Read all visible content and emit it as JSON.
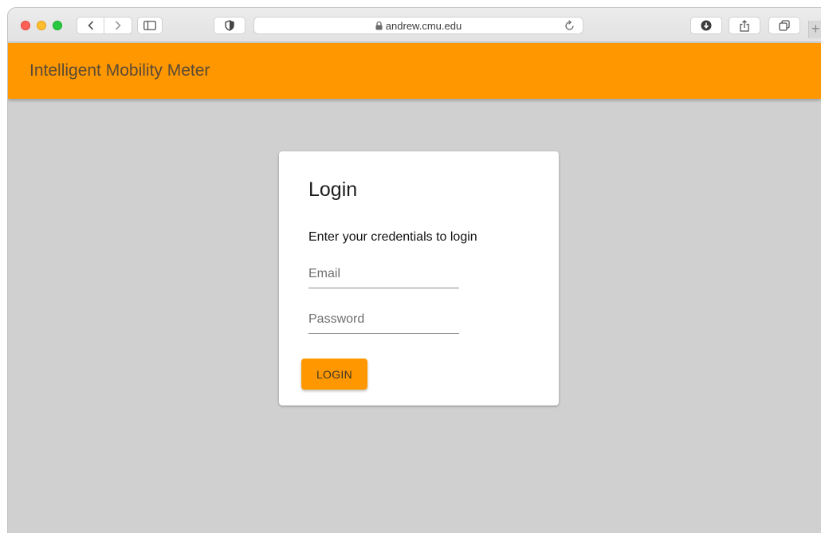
{
  "browser": {
    "url": "andrew.cmu.edu",
    "icons": {
      "back": "chevron-left-icon",
      "forward": "chevron-right-icon",
      "sidebar": "sidebar-icon",
      "privacy": "shield-icon",
      "lock": "lock-icon",
      "reload": "reload-icon",
      "downloads": "download-icon",
      "share": "share-icon",
      "tabs": "tabs-overview-icon",
      "new_tab": "plus-icon"
    },
    "new_tab_glyph": "+"
  },
  "app": {
    "title": "Intelligent Mobility Meter",
    "colors": {
      "accent": "#ff9800",
      "background": "#d0d0d0"
    }
  },
  "login": {
    "title": "Login",
    "subtitle": "Enter your credentials to login",
    "email": {
      "placeholder": "Email",
      "value": ""
    },
    "password": {
      "placeholder": "Password",
      "value": ""
    },
    "button_label": "LOGIN"
  }
}
